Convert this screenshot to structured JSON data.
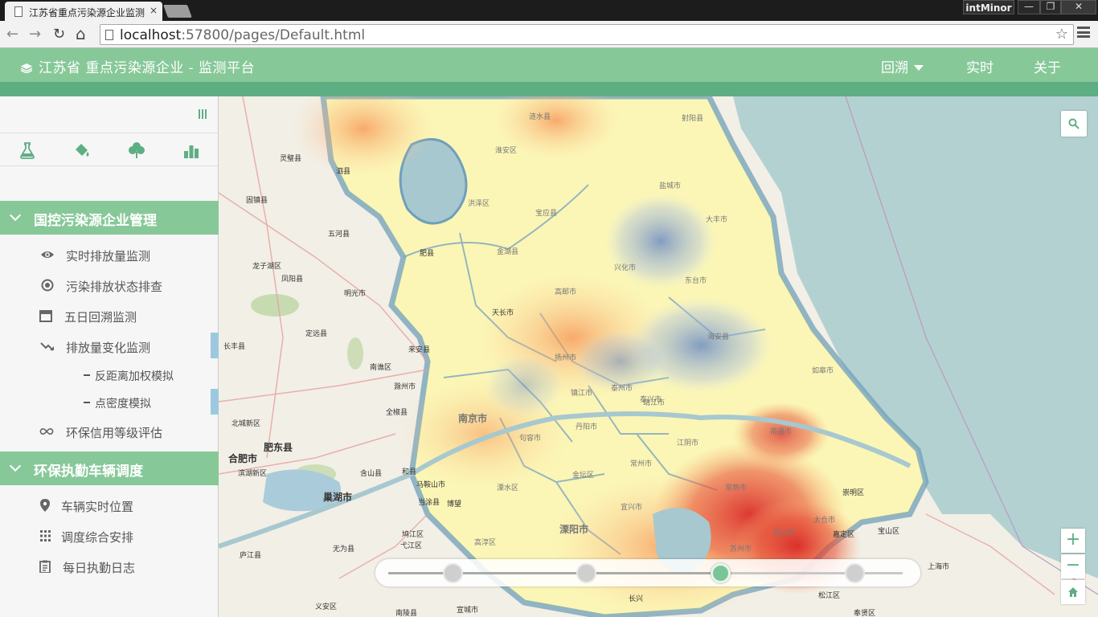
{
  "browser": {
    "tab_title": "江苏省重点污染源企业监测",
    "tab_close": "×",
    "profile": "intMinor",
    "window_min": "—",
    "window_max": "❐",
    "window_close": "✕",
    "url_host": "localhost",
    "url_path": ":57800/pages/Default.html",
    "back_glyph": "←",
    "forward_glyph": "→",
    "reload_glyph": "↻",
    "home_glyph": "⌂",
    "star_glyph": "☆"
  },
  "header": {
    "title": "江苏省 重点污染源企业 - 监测平台",
    "nav": [
      {
        "label": "回溯",
        "has_caret": true
      },
      {
        "label": "实时"
      },
      {
        "label": "关于"
      }
    ],
    "colors": {
      "bar": "#87c898",
      "strip": "#5eae84"
    }
  },
  "sidebar": {
    "tools": [
      {
        "icon": "flask-icon"
      },
      {
        "icon": "paint-bucket-icon"
      },
      {
        "icon": "tree-icon"
      },
      {
        "icon": "bar-chart-icon"
      }
    ],
    "sections": [
      {
        "title": "国控污染源企业管理",
        "items": [
          {
            "label": "实时排放量监测",
            "icon": "eye-icon"
          },
          {
            "label": "污染排放状态排查",
            "icon": "target-icon"
          },
          {
            "label": "五日回溯监测",
            "icon": "calendar-icon"
          },
          {
            "label": "排放量变化监测",
            "icon": "trend-down-icon"
          },
          {
            "label": "反距离加权模拟",
            "icon": "dash-icon"
          },
          {
            "label": "点密度模拟",
            "icon": "dash-icon"
          },
          {
            "label": "环保信用等级评估",
            "icon": "infinity-icon"
          }
        ]
      },
      {
        "title": "环保执勤车辆调度",
        "items": [
          {
            "label": "车辆实时位置",
            "icon": "map-pin-icon"
          },
          {
            "label": "调度综合安排",
            "icon": "grid-dots-icon"
          },
          {
            "label": "每日执勤日志",
            "icon": "clipboard-icon"
          }
        ]
      }
    ]
  },
  "map": {
    "labels": [
      {
        "text": "灵璧县"
      },
      {
        "text": "泗县"
      },
      {
        "text": "固镇县"
      },
      {
        "text": "五河县"
      },
      {
        "text": "龙子湖区"
      },
      {
        "text": "凤阳县"
      },
      {
        "text": "明光市"
      },
      {
        "text": "定远县"
      },
      {
        "text": "天长市"
      },
      {
        "text": "长丰县"
      },
      {
        "text": "南谯区"
      },
      {
        "text": "来安县"
      },
      {
        "text": "滁州市"
      },
      {
        "text": "全椒县"
      },
      {
        "text": "北城新区"
      },
      {
        "text": "肥东县"
      },
      {
        "text": "合肥市"
      },
      {
        "text": "滨湖新区"
      },
      {
        "text": "巢湖市"
      },
      {
        "text": "含山县"
      },
      {
        "text": "和县"
      },
      {
        "text": "马鞍山市"
      },
      {
        "text": "当涂县"
      },
      {
        "text": "博望"
      },
      {
        "text": "鸠江区"
      },
      {
        "text": "弋江区"
      },
      {
        "text": "无为县"
      },
      {
        "text": "庐江县"
      },
      {
        "text": "义安区"
      },
      {
        "text": "南陵县"
      },
      {
        "text": "宣城市"
      },
      {
        "text": "长兴"
      },
      {
        "text": "崇明区"
      },
      {
        "text": "嘉定区"
      },
      {
        "text": "宝山区"
      },
      {
        "text": "上海市"
      },
      {
        "text": "松江区"
      },
      {
        "text": "奉贤区"
      },
      {
        "text": "肥县"
      },
      {
        "text": "洪泽区"
      },
      {
        "text": "金湖县"
      },
      {
        "text": "宝应县"
      },
      {
        "text": "盐城市"
      },
      {
        "text": "大丰市"
      },
      {
        "text": "东台市"
      },
      {
        "text": "海安县"
      },
      {
        "text": "如皋市"
      },
      {
        "text": "南京市"
      },
      {
        "text": "扬州市"
      },
      {
        "text": "泰州市"
      },
      {
        "text": "靖江市"
      },
      {
        "text": "江阴市"
      },
      {
        "text": "常州市"
      },
      {
        "text": "常熟市"
      },
      {
        "text": "苏州市"
      },
      {
        "text": "溧阳市"
      },
      {
        "text": "高淳区"
      },
      {
        "text": "南通市"
      },
      {
        "text": "镇江市"
      },
      {
        "text": "兴化市"
      },
      {
        "text": "高邮市"
      },
      {
        "text": "泰兴市"
      },
      {
        "text": "丹阳市"
      },
      {
        "text": "句容市"
      },
      {
        "text": "溧水区"
      },
      {
        "text": "金坛区"
      },
      {
        "text": "宜兴市"
      },
      {
        "text": "太仓市"
      },
      {
        "text": "昆山市"
      },
      {
        "text": "射阳县"
      },
      {
        "text": "涟水县"
      },
      {
        "text": "淮安区"
      }
    ]
  },
  "controls": {
    "zoom_in": "+",
    "zoom_out": "−",
    "slider_active_index": 2,
    "slider_stops": 4
  }
}
